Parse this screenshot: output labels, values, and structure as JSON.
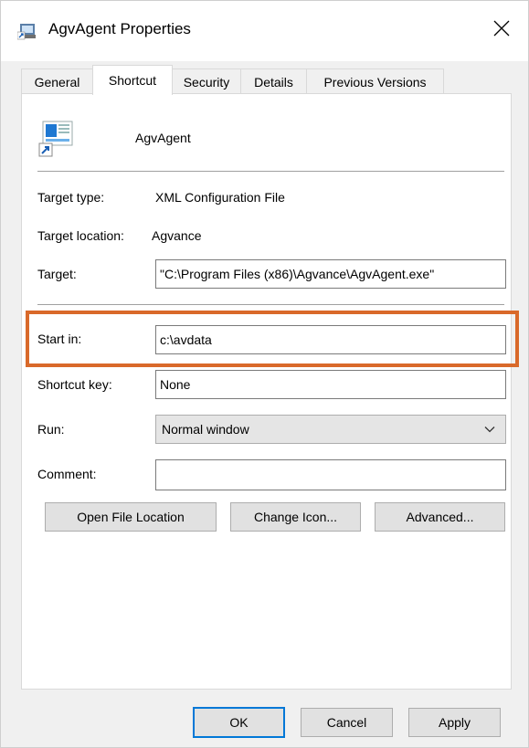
{
  "window": {
    "title": "AgvAgent Properties",
    "icon": "shortcut-app-icon",
    "close_glyph": "✕"
  },
  "tabs": [
    {
      "label": "General",
      "active": false
    },
    {
      "label": "Shortcut",
      "active": true
    },
    {
      "label": "Security",
      "active": false
    },
    {
      "label": "Details",
      "active": false
    },
    {
      "label": "Previous Versions",
      "active": false
    }
  ],
  "shortcut": {
    "name": "AgvAgent",
    "target_type_label": "Target type:",
    "target_type_value": "XML Configuration File",
    "target_location_label": "Target location:",
    "target_location_value": "Agvance",
    "target_label": "Target:",
    "target_value": "\"C:\\Program Files (x86)\\Agvance\\AgvAgent.exe\"",
    "start_in_label": "Start in:",
    "start_in_value": "c:\\avdata",
    "shortcut_key_label": "Shortcut key:",
    "shortcut_key_value": "None",
    "run_label": "Run:",
    "run_value": "Normal window",
    "comment_label": "Comment:",
    "comment_value": "",
    "open_file_location": "Open File Location",
    "change_icon": "Change Icon...",
    "advanced": "Advanced..."
  },
  "footer": {
    "ok": "OK",
    "cancel": "Cancel",
    "apply": "Apply"
  },
  "colors": {
    "highlight": "#d9692a",
    "accent": "#0078d7"
  }
}
